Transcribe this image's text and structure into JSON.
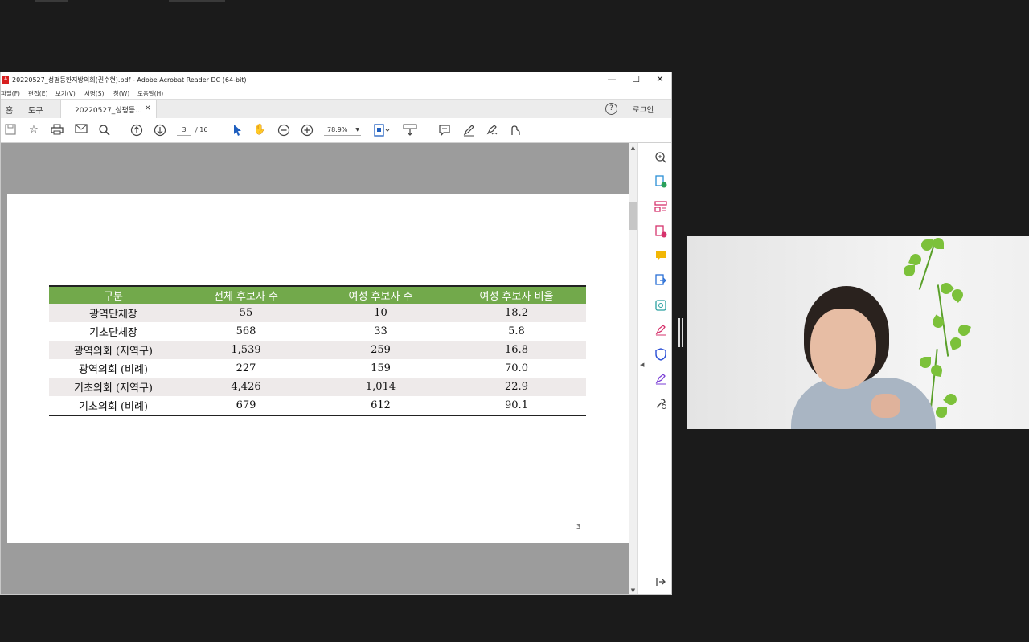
{
  "window": {
    "title": "20220527_성평등한지방의회(권수현).pdf - Adobe Acrobat Reader DC (64-bit)",
    "minimize_label": "—",
    "maximize_label": "☐",
    "close_label": "✕"
  },
  "menu": [
    "파일(F)",
    "편집(E)",
    "보기(V)",
    "서명(S)",
    "창(W)",
    "도움말(H)"
  ],
  "tabs": {
    "home": "홈",
    "tools": "도구",
    "document": "20220527_성평등...",
    "document_close": "×",
    "help": "?",
    "login": "로그인"
  },
  "toolbar": {
    "current_page": "3",
    "page_total": "/ 16",
    "zoom": "78.9%"
  },
  "document": {
    "page_number": "3",
    "table": {
      "headers": [
        "구분",
        "전체 후보자 수",
        "여성 후보자 수",
        "여성 후보자 비율"
      ],
      "rows": [
        [
          "광역단체장",
          "55",
          "10",
          "18.2"
        ],
        [
          "기초단체장",
          "568",
          "33",
          "5.8"
        ],
        [
          "광역의회 (지역구)",
          "1,539",
          "259",
          "16.8"
        ],
        [
          "광역의회 (비례)",
          "227",
          "159",
          "70.0"
        ],
        [
          "기초의회 (지역구)",
          "4,426",
          "1,014",
          "22.9"
        ],
        [
          "기초의회 (비례)",
          "679",
          "612",
          "90.1"
        ]
      ]
    }
  },
  "colors": {
    "table_header": "#72a94b",
    "row_shade": "#eeeaea",
    "page_gutter": "#9c9c9c",
    "acrobat_red": "#d71f1f"
  }
}
